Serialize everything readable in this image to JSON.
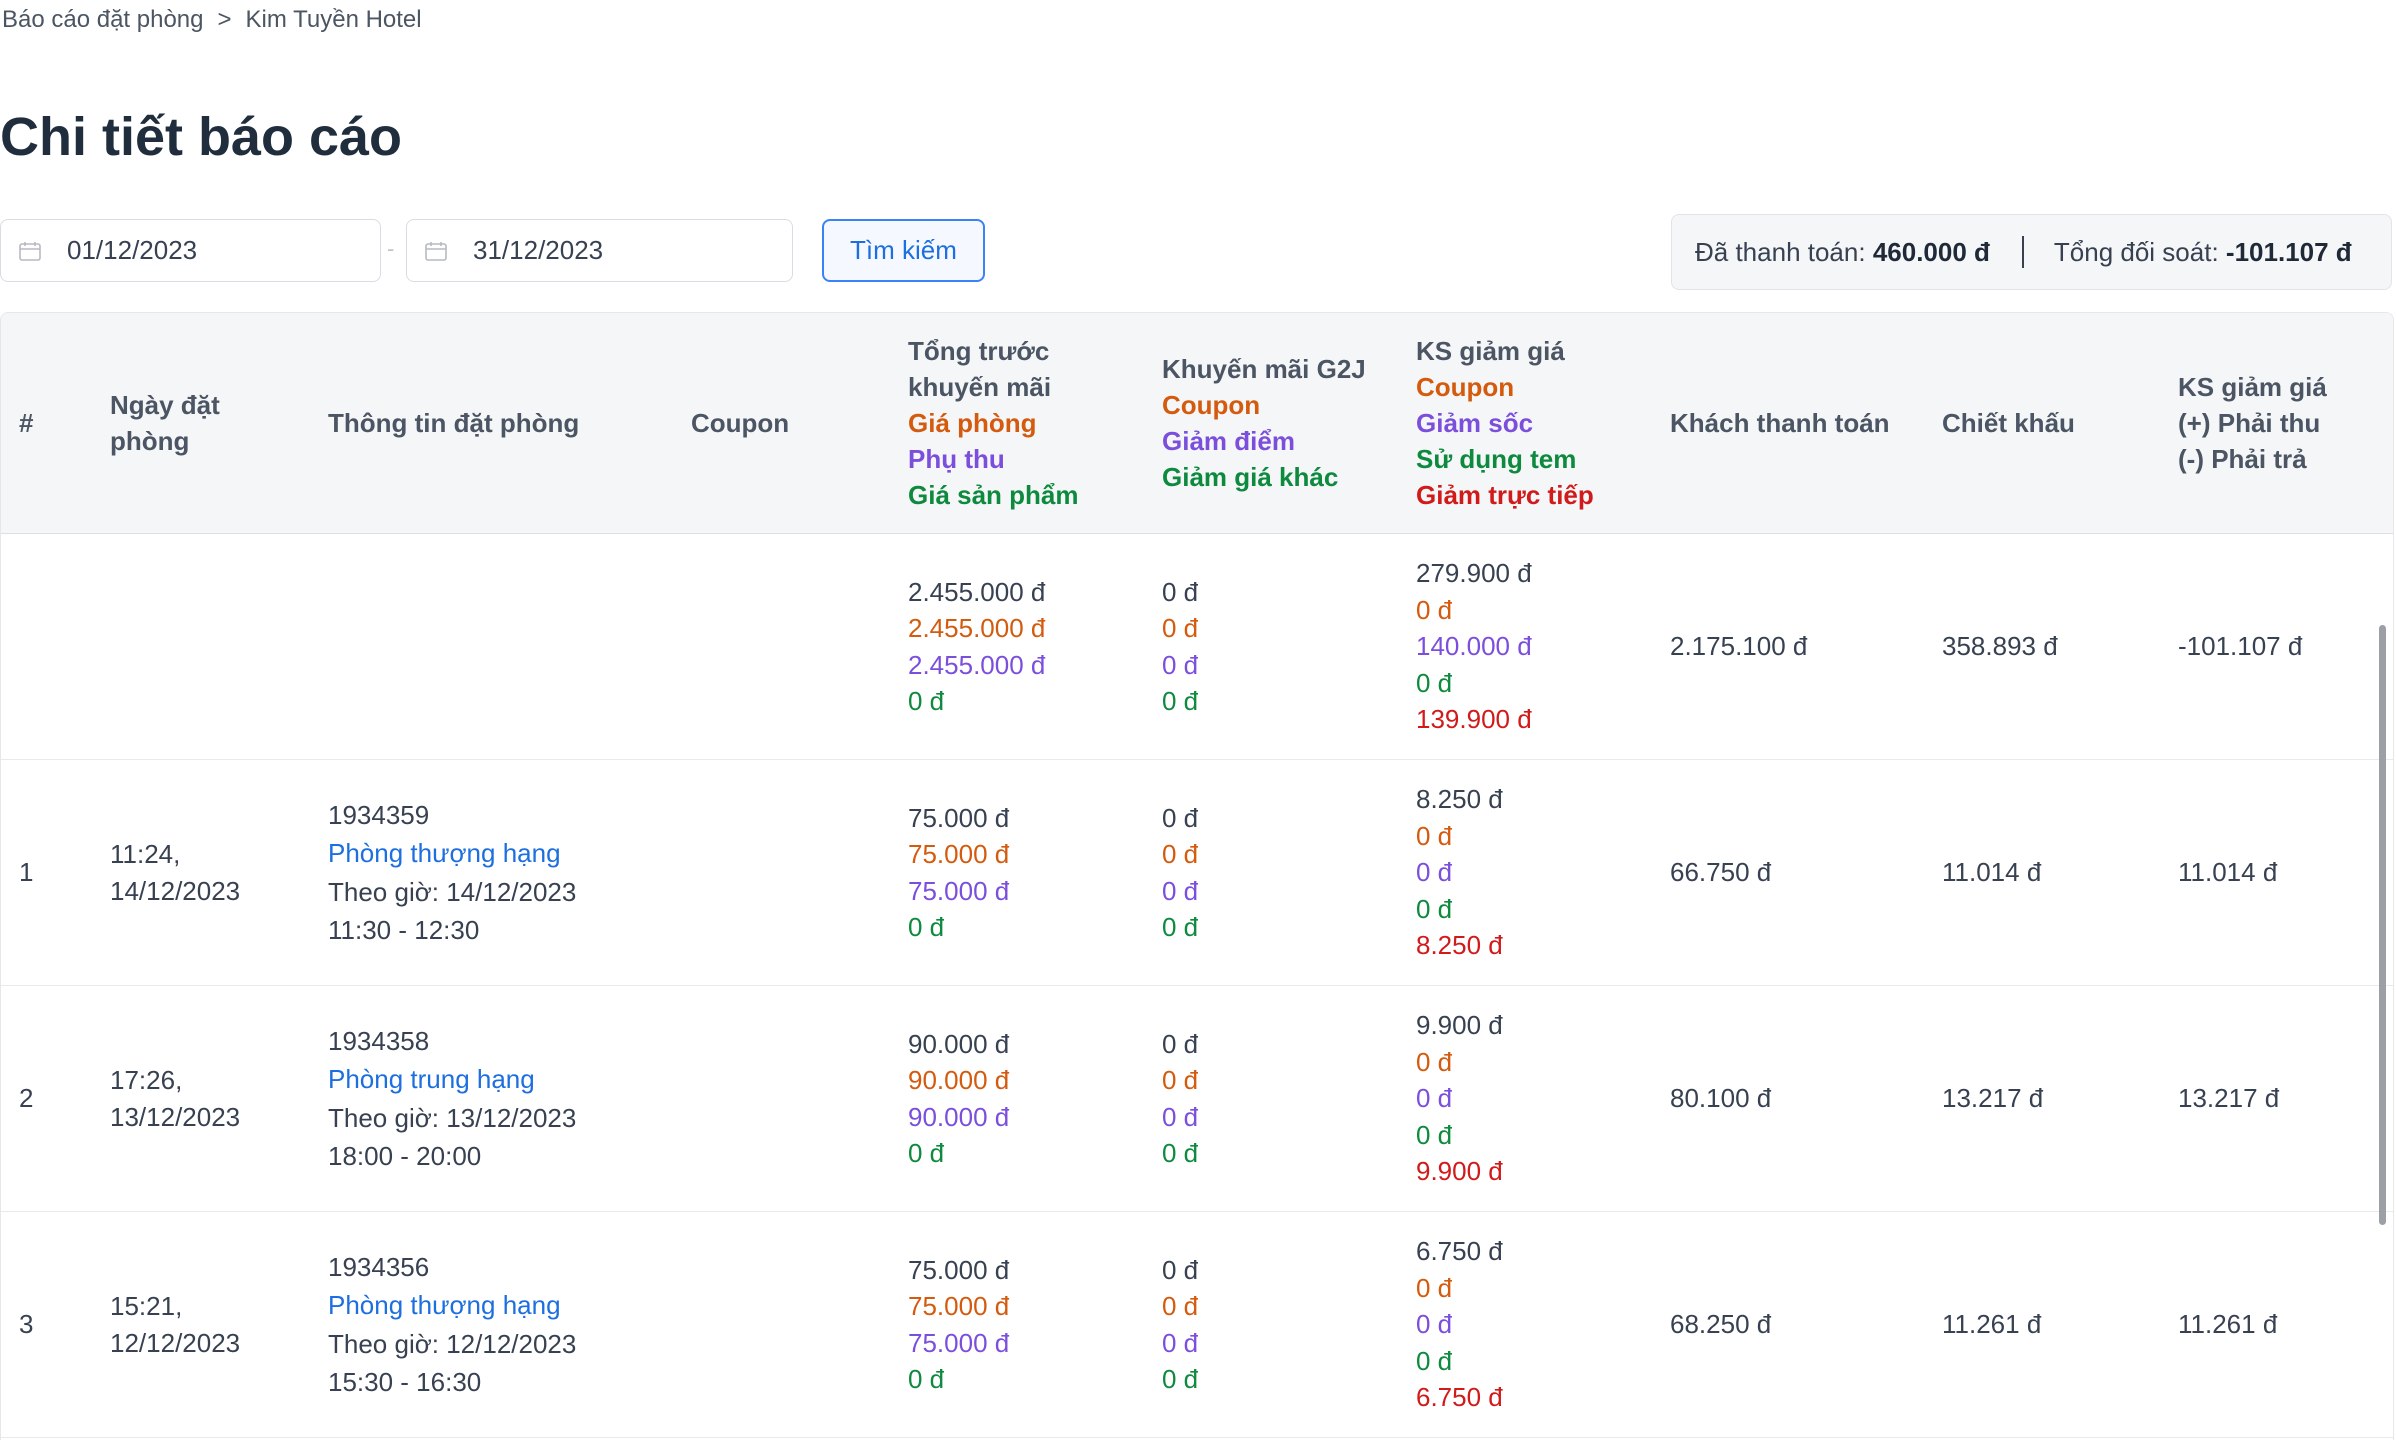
{
  "breadcrumb": {
    "parent": "Báo cáo đặt phòng",
    "separator": ">",
    "current": "Kim Tuyền Hotel"
  },
  "page_title": "Chi tiết báo cáo",
  "filters": {
    "start_date": "01/12/2023",
    "end_date": "31/12/2023",
    "date_separator": "-",
    "search_label": "Tìm kiếm"
  },
  "summary": {
    "paid_label": "Đã thanh toán:",
    "paid_value": "460.000 đ",
    "reconcile_label": "Tổng đối soát:",
    "reconcile_value": "-101.107 đ"
  },
  "table": {
    "headers": {
      "index": "#",
      "date": [
        "Ngày đặt",
        "phòng"
      ],
      "info": "Thông tin đặt phòng",
      "coupon": "Coupon",
      "total": [
        "Tổng trước",
        "khuyến mãi",
        "Giá phòng",
        "Phụ thu",
        "Giá sản phẩm"
      ],
      "g2j": [
        "Khuyến mãi G2J",
        "Coupon",
        "Giảm điểm",
        "Giảm giá khác"
      ],
      "ks": [
        "KS giảm giá",
        "Coupon",
        "Giảm sốc",
        "Sử dụng tem",
        "Giảm trực tiếp"
      ],
      "pay": "Khách thanh toán",
      "discount": "Chiết khấu",
      "final": [
        "KS giảm giá",
        "(+) Phải thu",
        "(-) Phải trả"
      ]
    },
    "summary_row": {
      "total": [
        "2.455.000 đ",
        "2.455.000 đ",
        "2.455.000 đ",
        "0 đ"
      ],
      "g2j": [
        "0 đ",
        "0 đ",
        "0 đ",
        "0 đ"
      ],
      "ks": [
        "279.900 đ",
        "0 đ",
        "140.000 đ",
        "0 đ",
        "139.900 đ"
      ],
      "pay": "2.175.100 đ",
      "discount": "358.893 đ",
      "final": "-101.107 đ"
    },
    "rows": [
      {
        "index": "1",
        "date": [
          "11:24,",
          "14/12/2023"
        ],
        "booking_id": "1934359",
        "room": "Phòng thượng hạng",
        "time_line": "Theo giờ: 14/12/2023",
        "time_range": "11:30 - 12:30",
        "coupon": "",
        "total": [
          "75.000 đ",
          "75.000 đ",
          "75.000 đ",
          "0 đ"
        ],
        "g2j": [
          "0 đ",
          "0 đ",
          "0 đ",
          "0 đ"
        ],
        "ks": [
          "8.250 đ",
          "0 đ",
          "0 đ",
          "0 đ",
          "8.250 đ"
        ],
        "pay": "66.750 đ",
        "discount": "11.014 đ",
        "final": "11.014 đ"
      },
      {
        "index": "2",
        "date": [
          "17:26,",
          "13/12/2023"
        ],
        "booking_id": "1934358",
        "room": "Phòng trung hạng",
        "time_line": "Theo giờ: 13/12/2023",
        "time_range": "18:00 - 20:00",
        "coupon": "",
        "total": [
          "90.000 đ",
          "90.000 đ",
          "90.000 đ",
          "0 đ"
        ],
        "g2j": [
          "0 đ",
          "0 đ",
          "0 đ",
          "0 đ"
        ],
        "ks": [
          "9.900 đ",
          "0 đ",
          "0 đ",
          "0 đ",
          "9.900 đ"
        ],
        "pay": "80.100 đ",
        "discount": "13.217 đ",
        "final": "13.217 đ"
      },
      {
        "index": "3",
        "date": [
          "15:21,",
          "12/12/2023"
        ],
        "booking_id": "1934356",
        "room": "Phòng thượng hạng",
        "time_line": "Theo giờ: 12/12/2023",
        "time_range": "15:30 - 16:30",
        "coupon": "",
        "total": [
          "75.000 đ",
          "75.000 đ",
          "75.000 đ",
          "0 đ"
        ],
        "g2j": [
          "0 đ",
          "0 đ",
          "0 đ",
          "0 đ"
        ],
        "ks": [
          "6.750 đ",
          "0 đ",
          "0 đ",
          "0 đ",
          "6.750 đ"
        ],
        "pay": "68.250 đ",
        "discount": "11.261 đ",
        "final": "11.261 đ"
      }
    ]
  },
  "colors": {
    "orange": "#d45b0e",
    "purple": "#7b4fdc",
    "green": "#0e8a3e",
    "red": "#d11a1a",
    "blue": "#1d6fe0"
  }
}
